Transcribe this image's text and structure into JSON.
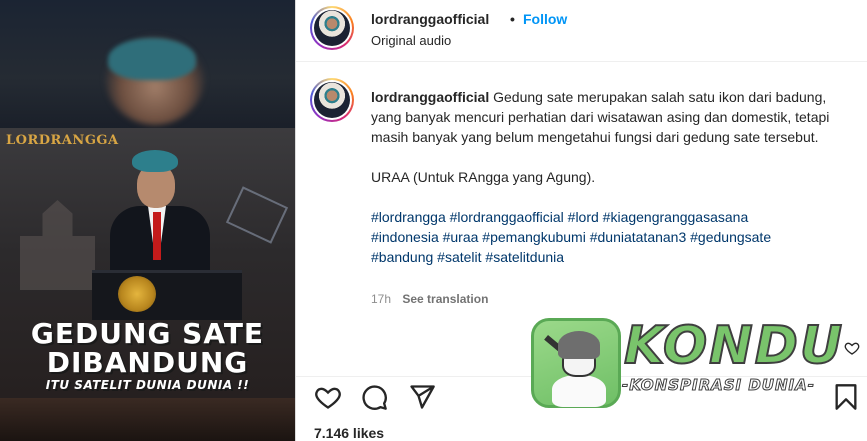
{
  "media": {
    "brand_logo": "LORDRANGGA",
    "headline_line1": "GEDUNG SATE",
    "headline_line2": "DIBANDUNG",
    "headline_line3": "ITU SATELIT DUNIA DUNIA !!"
  },
  "header": {
    "username": "lordranggaofficial",
    "separator": "•",
    "follow_label": "Follow",
    "audio": "Original audio"
  },
  "caption": {
    "username": "lordranggaofficial",
    "text": "Gedung sate merupakan salah satu ikon dari badung, yang banyak mencuri perhatian dari wisatawan asing dan domestik, tetapi masih banyak yang belum mengetahui fungsi dari gedung sate tersebut.",
    "line2": "URAA (Untuk RAngga yang Agung).",
    "hashtags_line1": "#lordrangga #lordranggaofficial #lord #kiagengranggasasana",
    "hashtags_line2": "#indonesia #uraa #pemangkubumi #duniatatanan3 #gedungsate",
    "hashtags_line3": "#bandung #satelit #satelitdunia",
    "time": "17h",
    "see_translation": "See translation"
  },
  "actions": {
    "icons": [
      "heart-icon",
      "comment-icon",
      "share-icon",
      "bookmark-icon"
    ],
    "likes": "7.146 likes"
  },
  "watermark": {
    "title": "KONDU",
    "subtitle": "-KONSPIRASI DUNIA-"
  },
  "colors": {
    "link_blue": "#0095f6",
    "hashtag": "#00376b",
    "muted": "#8e8e8e",
    "watermark_green": "#79c46b"
  }
}
